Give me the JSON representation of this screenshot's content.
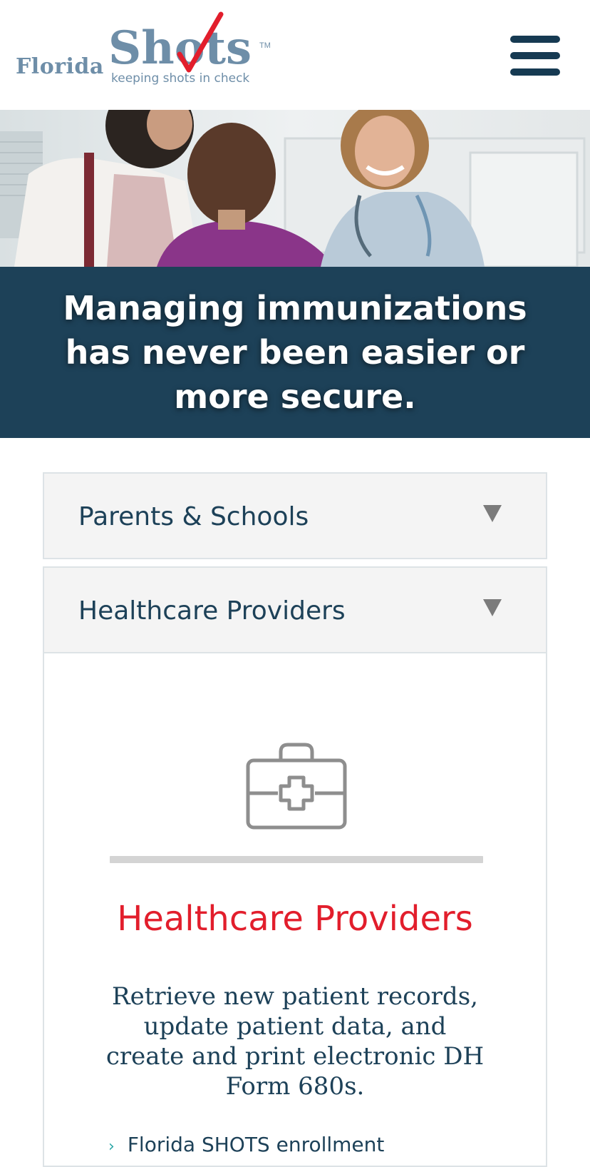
{
  "header": {
    "logo": {
      "word_florida": "Florida",
      "word_shots": "Shots",
      "trademark": "TM",
      "tagline": "keeping shots in check"
    },
    "menu_icon": "hamburger-menu-icon"
  },
  "hero": {
    "image_alt": "Parent and child talking with a smiling doctor",
    "title": "Managing immunizations has never been easier or more secure."
  },
  "accordion": {
    "items": [
      {
        "label": "Parents & Schools",
        "expanded": false
      },
      {
        "label": "Healthcare Providers",
        "expanded": true
      }
    ],
    "panel": {
      "icon": "medical-kit-icon",
      "title": "Healthcare Providers",
      "description": "Retrieve new patient records, update patient data, and create and print electronic DH Form 680s.",
      "links": [
        "Florida SHOTS enrollment"
      ]
    }
  },
  "colors": {
    "brand_navy": "#1d4158",
    "logo_blue": "#6e8ea8",
    "accent_red": "#e21e2c",
    "link_chevron": "#2aa6a6"
  }
}
